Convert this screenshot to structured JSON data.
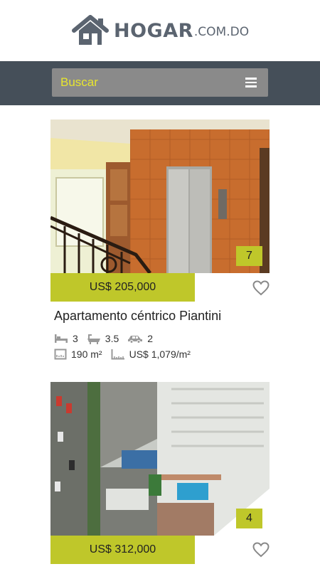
{
  "logo": {
    "brand": "HOGAR",
    "domain": ".COM.DO"
  },
  "search": {
    "placeholder": "Buscar"
  },
  "listings": [
    {
      "photo_count": "7",
      "price": "US$ 205,000",
      "title": "Apartamento céntrico Piantini",
      "bedrooms": "3",
      "bathrooms": "3.5",
      "parking": "2",
      "area": "190 m²",
      "price_per_m2": "US$ 1,079/m²"
    },
    {
      "photo_count": "4",
      "price": "US$ 312,000"
    }
  ],
  "colors": {
    "accent": "#bfc72a",
    "search_bar": "#454f59",
    "search_box": "#8a8a8a",
    "search_text": "#e7e52f",
    "logo": "#5b6470"
  }
}
